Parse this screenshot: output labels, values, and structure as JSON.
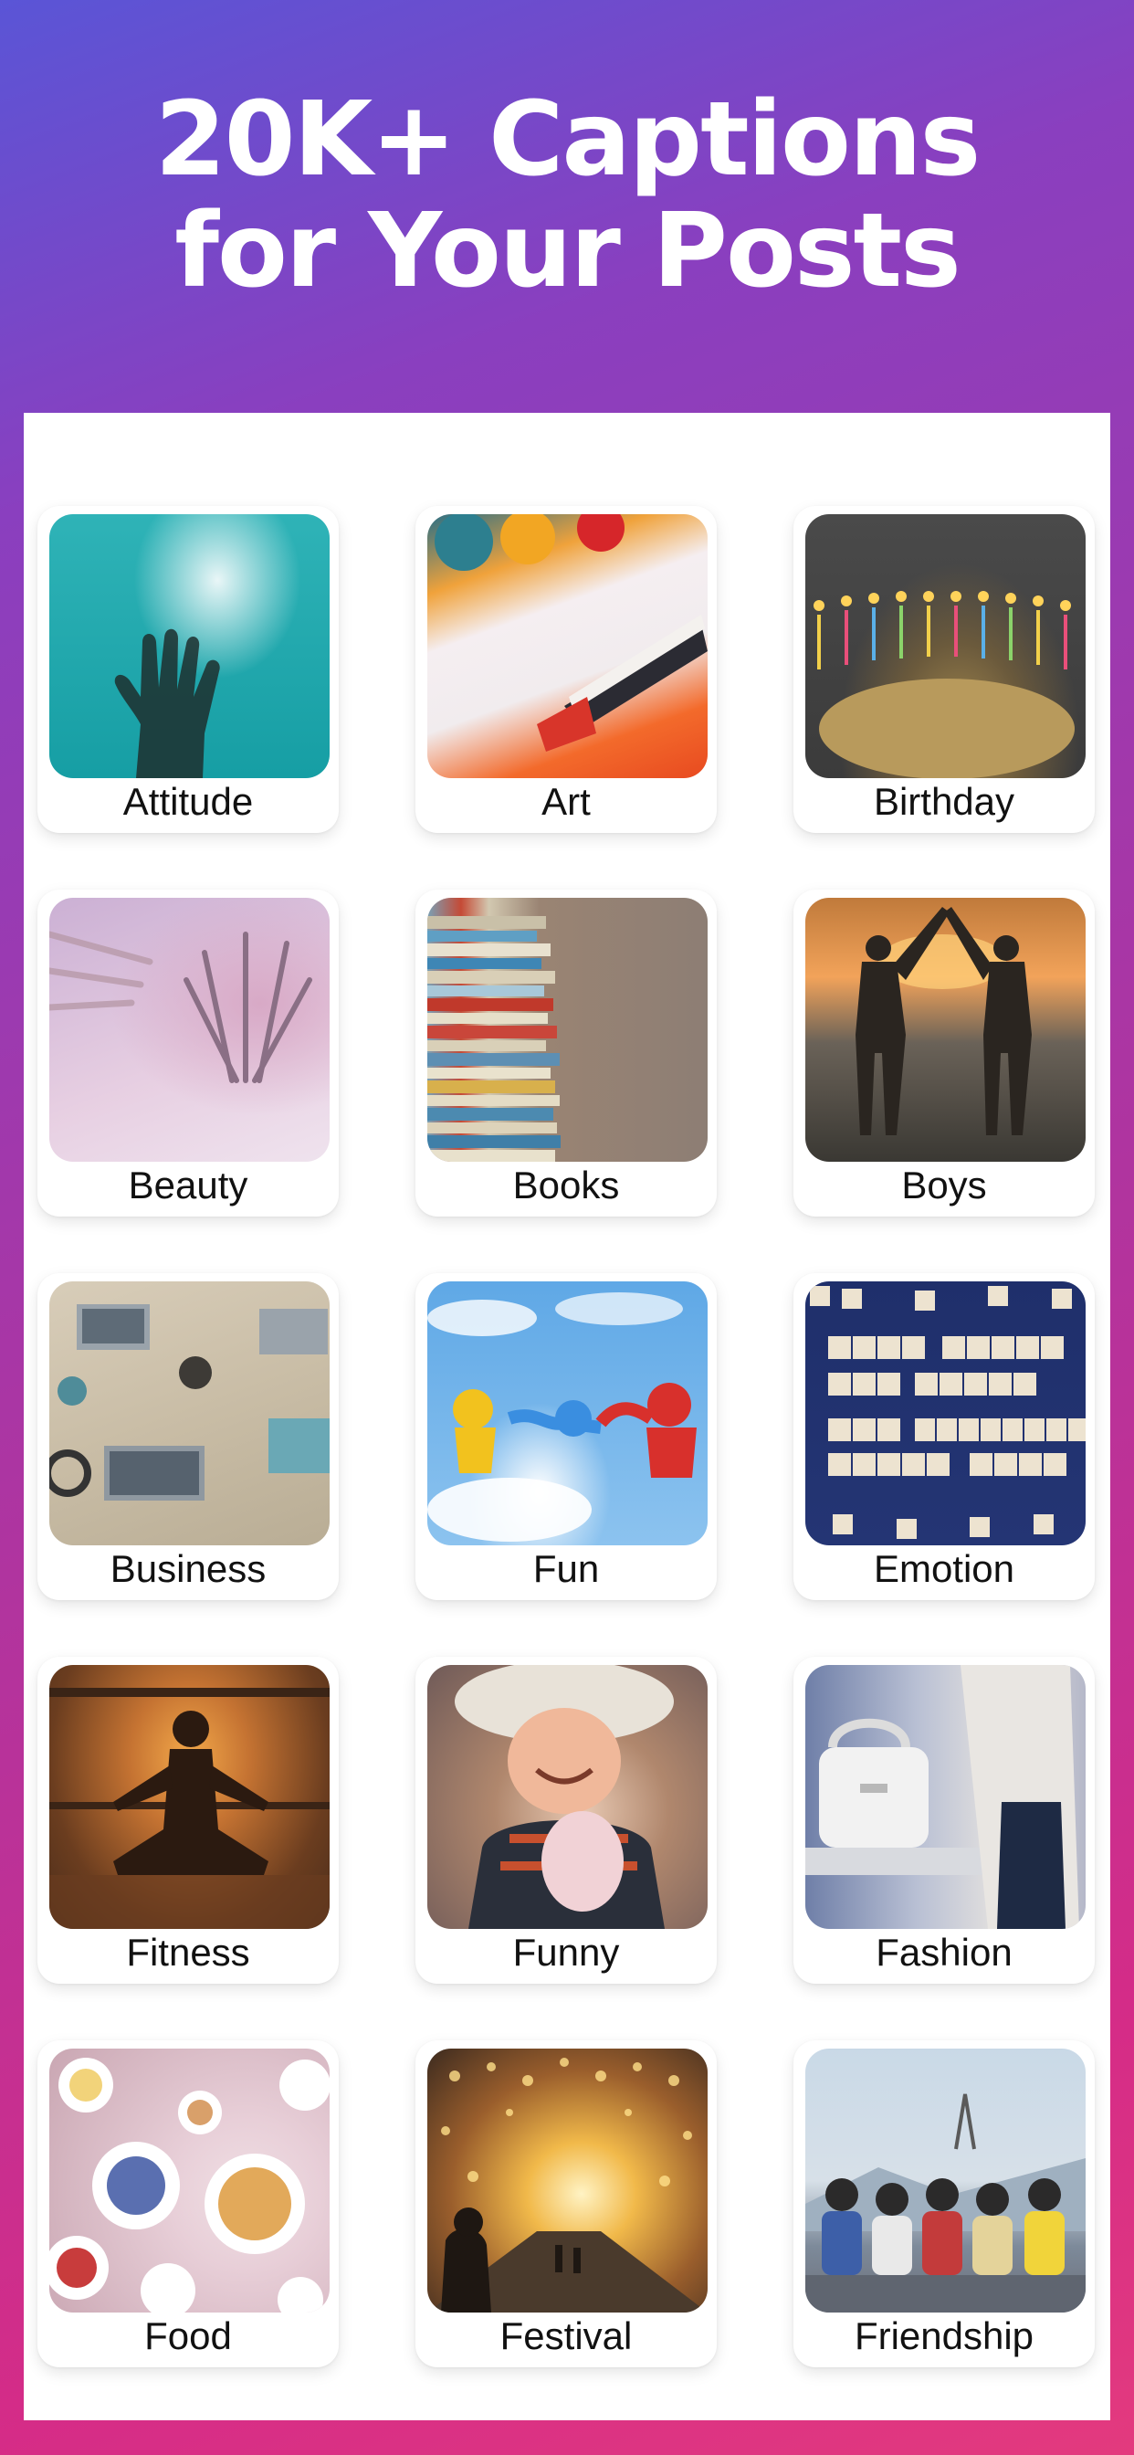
{
  "header": {
    "line1": "20K+ Captions",
    "line2": "for Your Posts"
  },
  "categories": [
    {
      "label": "Attitude",
      "image": "hand-sky-image"
    },
    {
      "label": "Art",
      "image": "paint-brush-image"
    },
    {
      "label": "Birthday",
      "image": "birthday-candles-image"
    },
    {
      "label": "Beauty",
      "image": "makeup-brushes-image"
    },
    {
      "label": "Books",
      "image": "book-stack-image"
    },
    {
      "label": "Boys",
      "image": "high-five-silhouette-image"
    },
    {
      "label": "Business",
      "image": "desk-laptops-image"
    },
    {
      "label": "Fun",
      "image": "toy-monkeys-image"
    },
    {
      "label": "Emotion",
      "image": "scrabble-tiles-image"
    },
    {
      "label": "Fitness",
      "image": "yoga-silhouette-image"
    },
    {
      "label": "Funny",
      "image": "smiling-child-image"
    },
    {
      "label": "Fashion",
      "image": "handbag-image"
    },
    {
      "label": "Food",
      "image": "food-table-image"
    },
    {
      "label": "Festival",
      "image": "lights-tunnel-image"
    },
    {
      "label": "Friendship",
      "image": "friends-group-image"
    }
  ],
  "colors": {
    "gradient_top": "#5a55d6",
    "gradient_mid": "#b0349f",
    "gradient_bottom": "#e33a7e",
    "panel": "#ffffff",
    "label_text": "#111111"
  }
}
